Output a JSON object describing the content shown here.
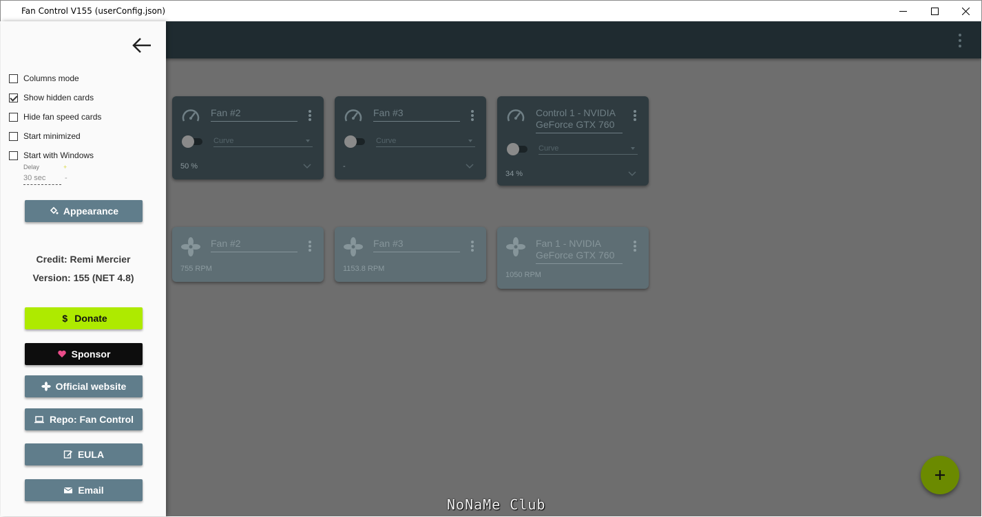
{
  "window": {
    "title": "Fan Control V155 (userConfig.json)"
  },
  "drawer": {
    "options": [
      {
        "label": "Columns mode",
        "checked": false
      },
      {
        "label": "Show hidden cards",
        "checked": true
      },
      {
        "label": "Hide fan speed cards",
        "checked": false
      },
      {
        "label": "Start minimized",
        "checked": false
      },
      {
        "label": "Start with Windows",
        "checked": false
      }
    ],
    "delay": {
      "label": "Delay",
      "value": "30 sec",
      "up_glyph": "+",
      "down_glyph": "-"
    },
    "appearance_label": "Appearance",
    "credit": "Credit: Remi Mercier",
    "version": "Version: 155 (NET 4.8)",
    "buttons": {
      "donate": "Donate",
      "sponsor": "Sponsor",
      "website": "Official website",
      "repo": "Repo: Fan Control",
      "eula": "EULA",
      "email": "Email"
    },
    "donate_glyph": "$"
  },
  "control_cards": [
    {
      "name": "Fan #2",
      "mode": "Curve",
      "value": "50 %"
    },
    {
      "name": "Fan #3",
      "mode": "Curve",
      "value": "-"
    },
    {
      "name": "Control 1 - NVIDIA GeForce GTX 760",
      "mode": "Curve",
      "value": "34 %"
    }
  ],
  "speed_cards": [
    {
      "name": "Fan #2",
      "value": "755 RPM"
    },
    {
      "name": "Fan #3",
      "value": "1153.8 RPM"
    },
    {
      "name": "Fan 1 - NVIDIA GeForce GTX 760",
      "value": "1050 RPM"
    }
  ],
  "watermark": "NoNaMe Club",
  "colors": {
    "appbar": "#1f2b30",
    "drawer_button": "#607d8b",
    "donate": "#aeea00",
    "fab": "#6b8a00",
    "sponsor_heart": "#ea4c89"
  }
}
